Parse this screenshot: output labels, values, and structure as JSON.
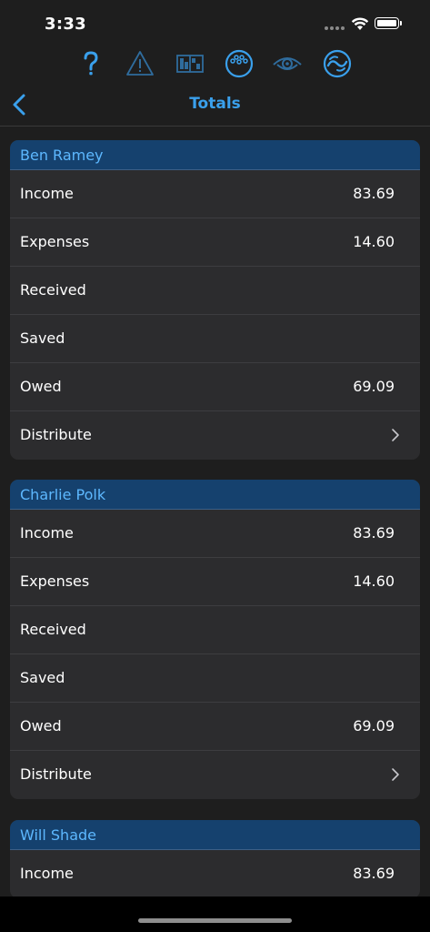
{
  "status": {
    "time": "3:33"
  },
  "toolbar": {
    "icons": [
      "help-icon",
      "warning-icon",
      "tables-icon",
      "bowling-ball-icon",
      "eye-icon",
      "refresh-icon"
    ],
    "accent": "#3aa0ec",
    "inactive": "#2f6c9d"
  },
  "nav": {
    "title": "Totals"
  },
  "people": [
    {
      "name": "Ben Ramey",
      "rows": [
        {
          "label": "Income",
          "value": "83.69"
        },
        {
          "label": "Expenses",
          "value": "14.60"
        },
        {
          "label": "Received",
          "value": ""
        },
        {
          "label": "Saved",
          "value": ""
        },
        {
          "label": "Owed",
          "value": "69.09"
        },
        {
          "label": "Distribute",
          "value": ""
        }
      ]
    },
    {
      "name": "Charlie Polk",
      "rows": [
        {
          "label": "Income",
          "value": "83.69"
        },
        {
          "label": "Expenses",
          "value": "14.60"
        },
        {
          "label": "Received",
          "value": ""
        },
        {
          "label": "Saved",
          "value": ""
        },
        {
          "label": "Owed",
          "value": "69.09"
        },
        {
          "label": "Distribute",
          "value": ""
        }
      ]
    },
    {
      "name": "Will Shade",
      "rows": [
        {
          "label": "Income",
          "value": "83.69"
        }
      ]
    }
  ]
}
